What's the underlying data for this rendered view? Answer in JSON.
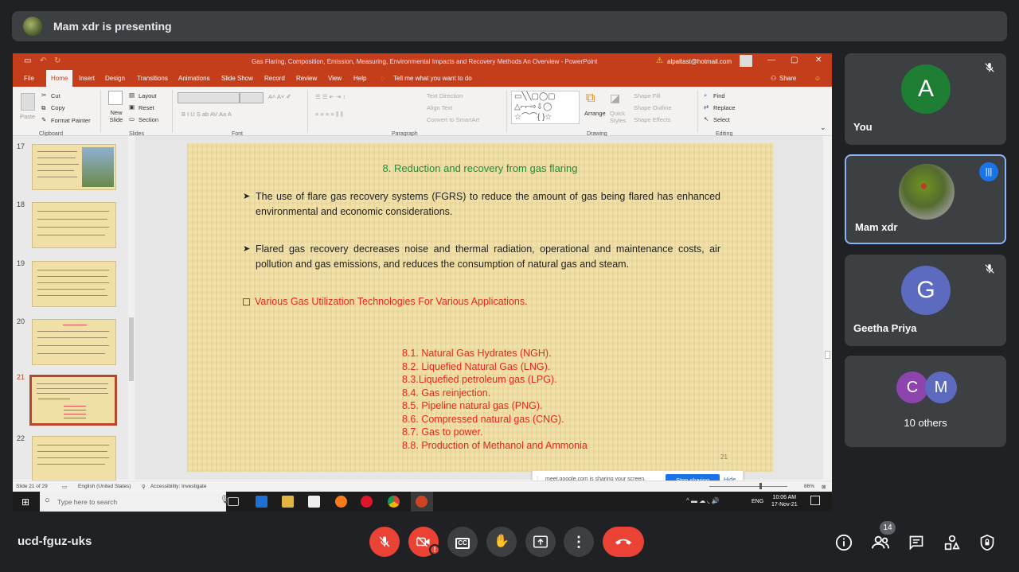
{
  "banner": {
    "text": "Mam xdr is presenting"
  },
  "ppt": {
    "window_title": "Gas Flaring, Composition, Emission, Measuring, Environmental Impacts and Recovery Methods An Overview - PowerPoint",
    "account": "alpaltast@hotmail.com",
    "tabs": [
      "File",
      "Home",
      "Insert",
      "Design",
      "Transitions",
      "Animations",
      "Slide Show",
      "Record",
      "Review",
      "View",
      "Help"
    ],
    "tell_me": "Tell me what you want to do",
    "share": "Share",
    "ribbon": {
      "cut": "Cut",
      "copy": "Copy",
      "format_painter": "Format Painter",
      "paste": "Paste",
      "new_slide": "New Slide",
      "layout": "Layout",
      "reset": "Reset",
      "section": "Section",
      "text_direction": "Text Direction",
      "align_text": "Align Text",
      "convert": "Convert to SmartArt",
      "arrange": "Arrange",
      "quick_styles": "Quick Styles",
      "shape_fill": "Shape Fill",
      "shape_outline": "Shape Outline",
      "shape_effects": "Shape Effects",
      "find": "Find",
      "replace": "Replace",
      "select": "Select",
      "groups": {
        "clipboard": "Clipboard",
        "slides": "Slides",
        "font": "Font",
        "paragraph": "Paragraph",
        "drawing": "Drawing",
        "editing": "Editing"
      }
    },
    "thumbnails": [
      "17",
      "18",
      "19",
      "20",
      "21",
      "22"
    ],
    "slide": {
      "title": "8. Reduction and recovery from gas flaring",
      "bullet1": "The use of flare gas recovery systems (FGRS) to reduce the amount of gas being flared has enhanced environmental and economic considerations.",
      "bullet2": "Flared gas recovery decreases noise and thermal radiation, operational and maintenance costs, air pollution and gas emissions, and reduces the consumption of natural gas and steam.",
      "subheading": "Various Gas Utilization Technologies For Various Applications.",
      "list": [
        "8.1.  Natural Gas Hydrates (NGH).",
        "8.2. Liquefied Natural Gas (LNG).",
        "8.3.Liquefied petroleum gas (LPG).",
        "8.4. Gas reinjection.",
        "8.5. Pipeline natural gas (PNG).",
        "8.6. Compressed natural gas (CNG).",
        "8.7. Gas to power.",
        "8.8. Production of Methanol and Ammonia"
      ],
      "page_number": "21"
    },
    "share_notice": {
      "message": "meet.google.com is sharing your screen.",
      "stop": "Stop sharing",
      "hide": "Hide"
    },
    "status": {
      "slide": "Slide 21 of 29",
      "language": "English (United States)",
      "accessibility": "Accessibility: Investigate",
      "zoom": "86%"
    },
    "taskbar": {
      "search": "Type here to search",
      "lang": "ENG",
      "time": "10:06 AM",
      "date": "17-Nov-21"
    }
  },
  "participants": [
    {
      "initial": "A",
      "name": "You",
      "color": "#1e7e34"
    },
    {
      "name": "Mam xdr"
    },
    {
      "initial": "G",
      "name": "Geetha Priya",
      "color": "#5c6bc0"
    }
  ],
  "others": {
    "initials": [
      "C",
      "M"
    ],
    "label": "10 others",
    "colors": [
      "#8e44ad",
      "#5c6bc0"
    ]
  },
  "meeting": {
    "code": "ucd-fguz-uks",
    "people_count": "14"
  }
}
